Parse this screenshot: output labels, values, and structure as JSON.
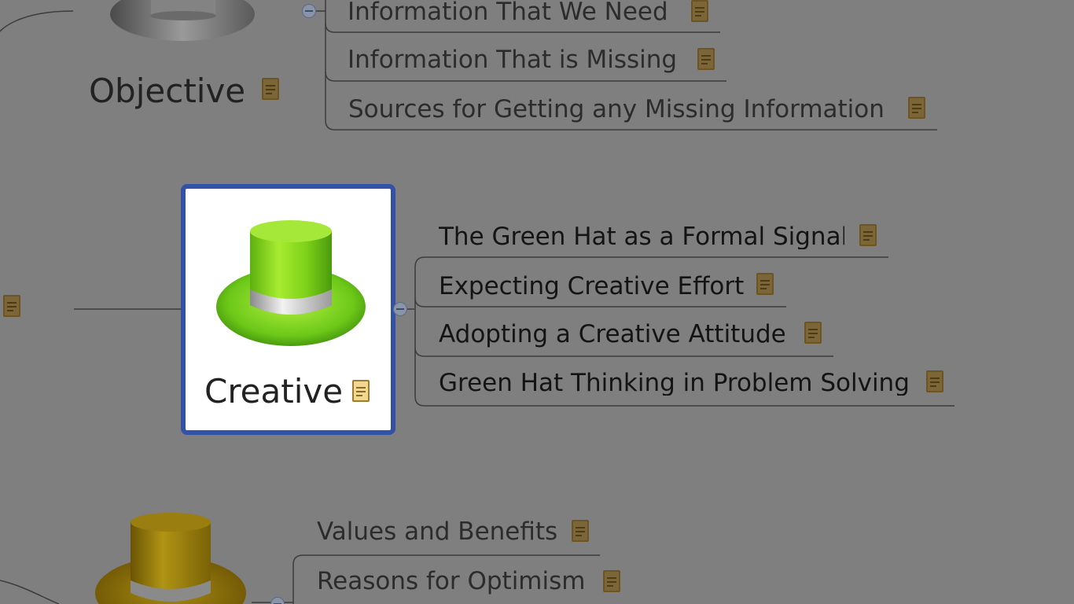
{
  "map": {
    "objective": {
      "label": "Objective",
      "subtopics": [
        "Information That We Need",
        "Information That is Missing",
        "Sources for Getting any Missing Information"
      ]
    },
    "creative": {
      "label": "Creative",
      "subtopics": [
        "The Green Hat as a Formal Signal",
        "Expecting Creative Effort",
        "Adopting a Creative Attitude",
        "Green Hat Thinking in Problem Solving"
      ]
    },
    "optimistic": {
      "subtopics": [
        "Values and Benefits",
        "Reasons for Optimism"
      ]
    }
  },
  "icons": {
    "note": "note-icon",
    "collapse": "collapse-toggle-icon",
    "white_hat": "white-hat-icon",
    "green_hat": "green-hat-icon",
    "yellow_hat": "yellow-hat-icon"
  },
  "colors": {
    "overlay": "#7f7f7f",
    "focus_border": "#3451a8",
    "green_hat": "#8ad820",
    "note_icon": "#e8c670",
    "connector": "#3c3c3c"
  }
}
